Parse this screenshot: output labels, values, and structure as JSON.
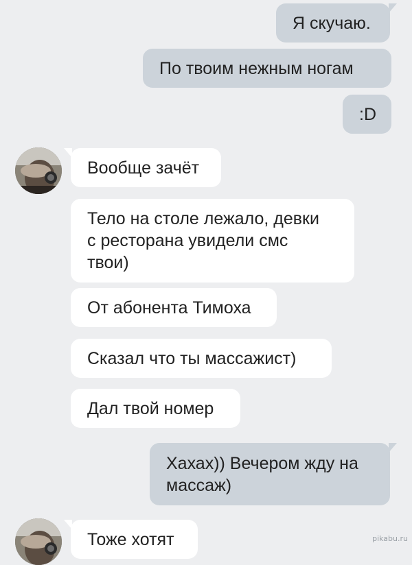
{
  "messages": [
    {
      "id": "m1",
      "dir": "out",
      "text": "Я скучаю."
    },
    {
      "id": "m2",
      "dir": "out",
      "text": "По твоим нежным ногам"
    },
    {
      "id": "m3",
      "dir": "out",
      "text": ":D"
    },
    {
      "id": "m4",
      "dir": "in",
      "text": "Вообще зачёт"
    },
    {
      "id": "m5",
      "dir": "in",
      "text": "Тело на столе лежало, девки\nс ресторана увидели смс\nтвои)"
    },
    {
      "id": "m6",
      "dir": "in",
      "text": "От абонента Тимоха"
    },
    {
      "id": "m7",
      "dir": "in",
      "text": "Сказал что ты массажист)"
    },
    {
      "id": "m8",
      "dir": "in",
      "text": "Дал твой номер"
    },
    {
      "id": "m9",
      "dir": "out",
      "text": "Хахах)) Вечером жду на\nмассаж)"
    },
    {
      "id": "m10",
      "dir": "in",
      "text": "Тоже хотят"
    }
  ],
  "watermark": "pikabu.ru",
  "colors": {
    "background": "#edeef0",
    "outgoing": "#ccd3da",
    "incoming": "#ffffff",
    "text": "#222222"
  }
}
